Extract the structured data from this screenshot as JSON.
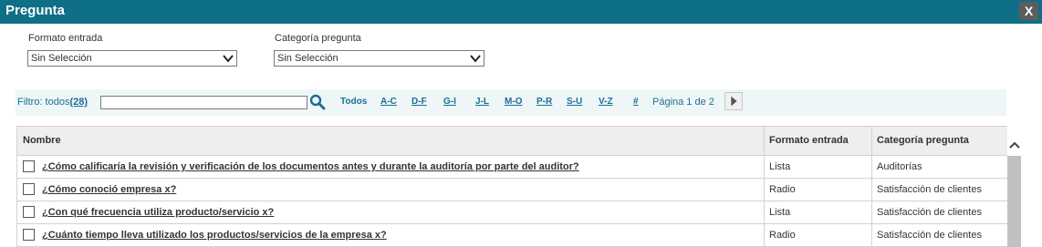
{
  "window": {
    "title": "Pregunta",
    "close_label": "X"
  },
  "filters": {
    "formato_label": "Formato entrada",
    "formato_value": "Sin Selección",
    "categoria_label": "Categoría pregunta",
    "categoria_value": "Sin Selección"
  },
  "filterbar": {
    "prefix": "Filtro: todos",
    "count": "(28)",
    "input_value": "",
    "todos_label": "Todos",
    "letters": [
      "A-C",
      "D-F",
      "G-I",
      "J-L",
      "M-O",
      "P-R",
      "S-U",
      "V-Z",
      "#"
    ],
    "page_text": "Página 1 de 2"
  },
  "table": {
    "headers": {
      "name": "Nombre",
      "format": "Formato entrada",
      "category": "Categoría pregunta"
    },
    "rows": [
      {
        "name": "¿Cómo calificaría la revisión y verificación de los documentos antes y durante la auditoría por parte del auditor?",
        "format": "Lista",
        "category": "Auditorías"
      },
      {
        "name": "¿Cómo conoció empresa x?",
        "format": "Radio",
        "category": "Satisfacción de clientes"
      },
      {
        "name": "¿Con qué frecuencia utiliza producto/servicio x?",
        "format": "Lista",
        "category": "Satisfacción de clientes"
      },
      {
        "name": "¿Cuánto tiempo lleva utilizado los productos/servicios de la empresa x?",
        "format": "Radio",
        "category": "Satisfacción de clientes"
      }
    ]
  },
  "icons": {
    "close": "close-icon",
    "search": "search-icon",
    "next": "chevron-right-icon",
    "dropdown": "chevron-down-icon",
    "scroll_up": "chevron-up-icon"
  },
  "colors": {
    "titlebar": "#0e6f86",
    "link": "#1c6f93",
    "filterbar_bg": "#eef6f8",
    "header_bg": "#eeeeee"
  }
}
